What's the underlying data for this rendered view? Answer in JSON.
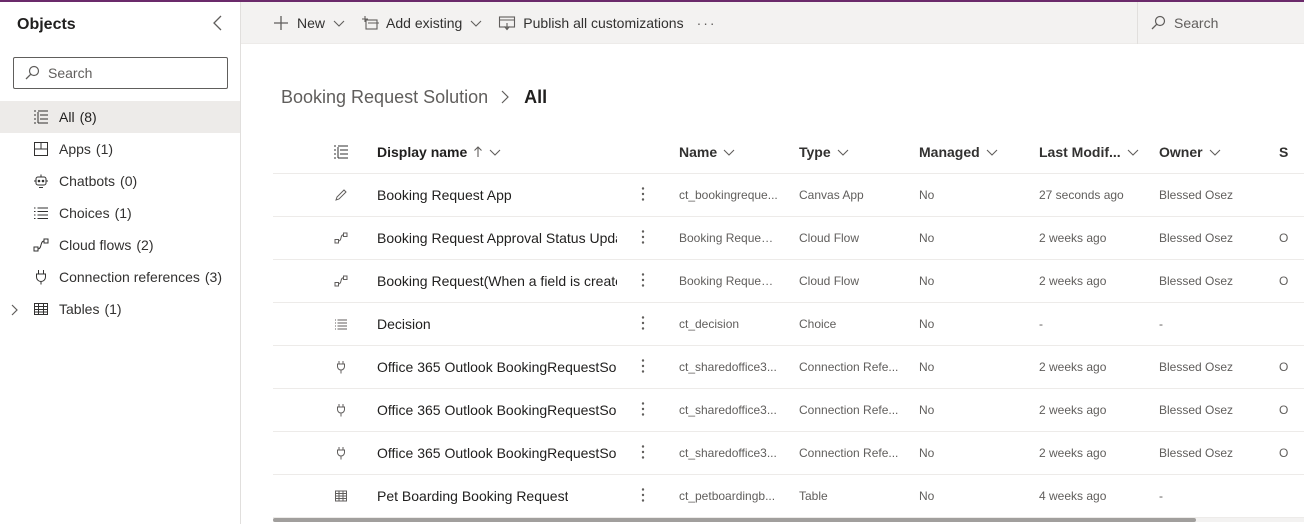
{
  "sidebar": {
    "title": "Objects",
    "search_placeholder": "Search",
    "items": [
      {
        "label": "All",
        "count": "(8)",
        "icon": "list-icon",
        "active": true
      },
      {
        "label": "Apps",
        "count": "(1)",
        "icon": "apps-icon"
      },
      {
        "label": "Chatbots",
        "count": "(0)",
        "icon": "chatbot-icon"
      },
      {
        "label": "Choices",
        "count": "(1)",
        "icon": "choices-icon"
      },
      {
        "label": "Cloud flows",
        "count": "(2)",
        "icon": "flow-icon"
      },
      {
        "label": "Connection references",
        "count": "(3)",
        "icon": "plug-icon"
      },
      {
        "label": "Tables",
        "count": "(1)",
        "icon": "table-icon",
        "expandable": true
      }
    ]
  },
  "toolbar": {
    "new_label": "New",
    "add_existing_label": "Add existing",
    "publish_label": "Publish all customizations",
    "more_label": "···",
    "search_label": "Search"
  },
  "breadcrumb": {
    "root": "Booking Request Solution",
    "current": "All"
  },
  "grid": {
    "headers": {
      "display_name": "Display name",
      "name": "Name",
      "type": "Type",
      "managed": "Managed",
      "last_modified": "Last Modif...",
      "owner": "Owner",
      "status": "S"
    },
    "rows": [
      {
        "icon": "pencil-icon",
        "display_name": "Booking Request App",
        "name": "ct_bookingreque...",
        "type": "Canvas App",
        "managed": "No",
        "modified": "27 seconds ago",
        "owner": "Blessed Osez",
        "status": ""
      },
      {
        "icon": "flow-icon",
        "display_name": "Booking Request Approval Status Upda",
        "name": "Booking Request...",
        "type": "Cloud Flow",
        "managed": "No",
        "modified": "2 weeks ago",
        "owner": "Blessed Osez",
        "status": "O"
      },
      {
        "icon": "flow-icon",
        "display_name": "Booking Request(When a field is create",
        "name": "Booking Request...",
        "type": "Cloud Flow",
        "managed": "No",
        "modified": "2 weeks ago",
        "owner": "Blessed Osez",
        "status": "O"
      },
      {
        "icon": "choices-icon",
        "display_name": "Decision",
        "name": "ct_decision",
        "type": "Choice",
        "managed": "No",
        "modified": "-",
        "owner": "-",
        "status": ""
      },
      {
        "icon": "plug-icon",
        "display_name": "Office 365 Outlook BookingRequestSo",
        "name": "ct_sharedoffice3...",
        "type": "Connection Refe...",
        "managed": "No",
        "modified": "2 weeks ago",
        "owner": "Blessed Osez",
        "status": "O"
      },
      {
        "icon": "plug-icon",
        "display_name": "Office 365 Outlook BookingRequestSo",
        "name": "ct_sharedoffice3...",
        "type": "Connection Refe...",
        "managed": "No",
        "modified": "2 weeks ago",
        "owner": "Blessed Osez",
        "status": "O"
      },
      {
        "icon": "plug-icon",
        "display_name": "Office 365 Outlook BookingRequestSo",
        "name": "ct_sharedoffice3...",
        "type": "Connection Refe...",
        "managed": "No",
        "modified": "2 weeks ago",
        "owner": "Blessed Osez",
        "status": "O"
      },
      {
        "icon": "table-icon",
        "display_name": "Pet Boarding Booking Request",
        "name": "ct_petboardingb...",
        "type": "Table",
        "managed": "No",
        "modified": "4 weeks ago",
        "owner": "-",
        "status": ""
      }
    ]
  },
  "colors": {
    "accent_bar": "#6b2a6b",
    "toolbar_bg": "#f3f2f1",
    "active_item_bg": "#edebe9"
  }
}
